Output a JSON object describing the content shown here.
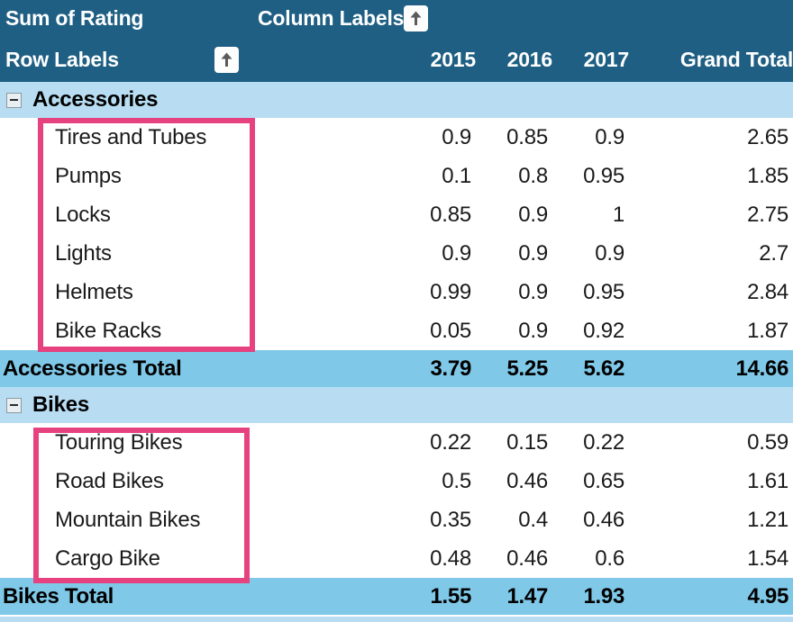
{
  "header": {
    "value_field_label": "Sum of Rating",
    "column_labels_label": "Column Labels",
    "row_labels_label": "Row Labels",
    "column_headers": [
      "2015",
      "2016",
      "2017",
      "Grand Total"
    ],
    "sort_icon": "sort-ascending-arrow-icon",
    "background_color": "#1e5f83",
    "text_color": "#ffffff"
  },
  "colors": {
    "header_bg": "#1e5f83",
    "group_row_bg": "#b8ddf2",
    "total_row_bg": "#7fc8e8",
    "item_row_bg": "#ffffff",
    "highlight_outline": "#e6427f",
    "text_dark": "#000000"
  },
  "groups": [
    {
      "name": "Accessories",
      "expanded": true,
      "collapse_icon": "minus-square-icon",
      "items": [
        {
          "label": "Tires and Tubes",
          "y2015": "0.9",
          "y2016": "0.85",
          "y2017": "0.9",
          "grand_total": "2.65"
        },
        {
          "label": "Pumps",
          "y2015": "0.1",
          "y2016": "0.8",
          "y2017": "0.95",
          "grand_total": "1.85"
        },
        {
          "label": "Locks",
          "y2015": "0.85",
          "y2016": "0.9",
          "y2017": "1",
          "grand_total": "2.75"
        },
        {
          "label": "Lights",
          "y2015": "0.9",
          "y2016": "0.9",
          "y2017": "0.9",
          "grand_total": "2.7"
        },
        {
          "label": "Helmets",
          "y2015": "0.99",
          "y2016": "0.9",
          "y2017": "0.95",
          "grand_total": "2.84"
        },
        {
          "label": "Bike Racks",
          "y2015": "0.05",
          "y2016": "0.9",
          "y2017": "0.92",
          "grand_total": "1.87"
        }
      ],
      "total": {
        "label": "Accessories Total",
        "y2015": "3.79",
        "y2016": "5.25",
        "y2017": "5.62",
        "grand_total": "14.66"
      }
    },
    {
      "name": "Bikes",
      "expanded": true,
      "collapse_icon": "minus-square-icon",
      "items": [
        {
          "label": "Touring Bikes",
          "y2015": "0.22",
          "y2016": "0.15",
          "y2017": "0.22",
          "grand_total": "0.59"
        },
        {
          "label": "Road Bikes",
          "y2015": "0.5",
          "y2016": "0.46",
          "y2017": "0.65",
          "grand_total": "1.61"
        },
        {
          "label": "Mountain Bikes",
          "y2015": "0.35",
          "y2016": "0.4",
          "y2017": "0.46",
          "grand_total": "1.21"
        },
        {
          "label": "Cargo Bike",
          "y2015": "0.48",
          "y2016": "0.46",
          "y2017": "0.6",
          "grand_total": "1.54"
        }
      ],
      "total": {
        "label": "Bikes Total",
        "y2015": "1.55",
        "y2016": "1.47",
        "y2017": "1.93",
        "grand_total": "4.95"
      }
    }
  ]
}
